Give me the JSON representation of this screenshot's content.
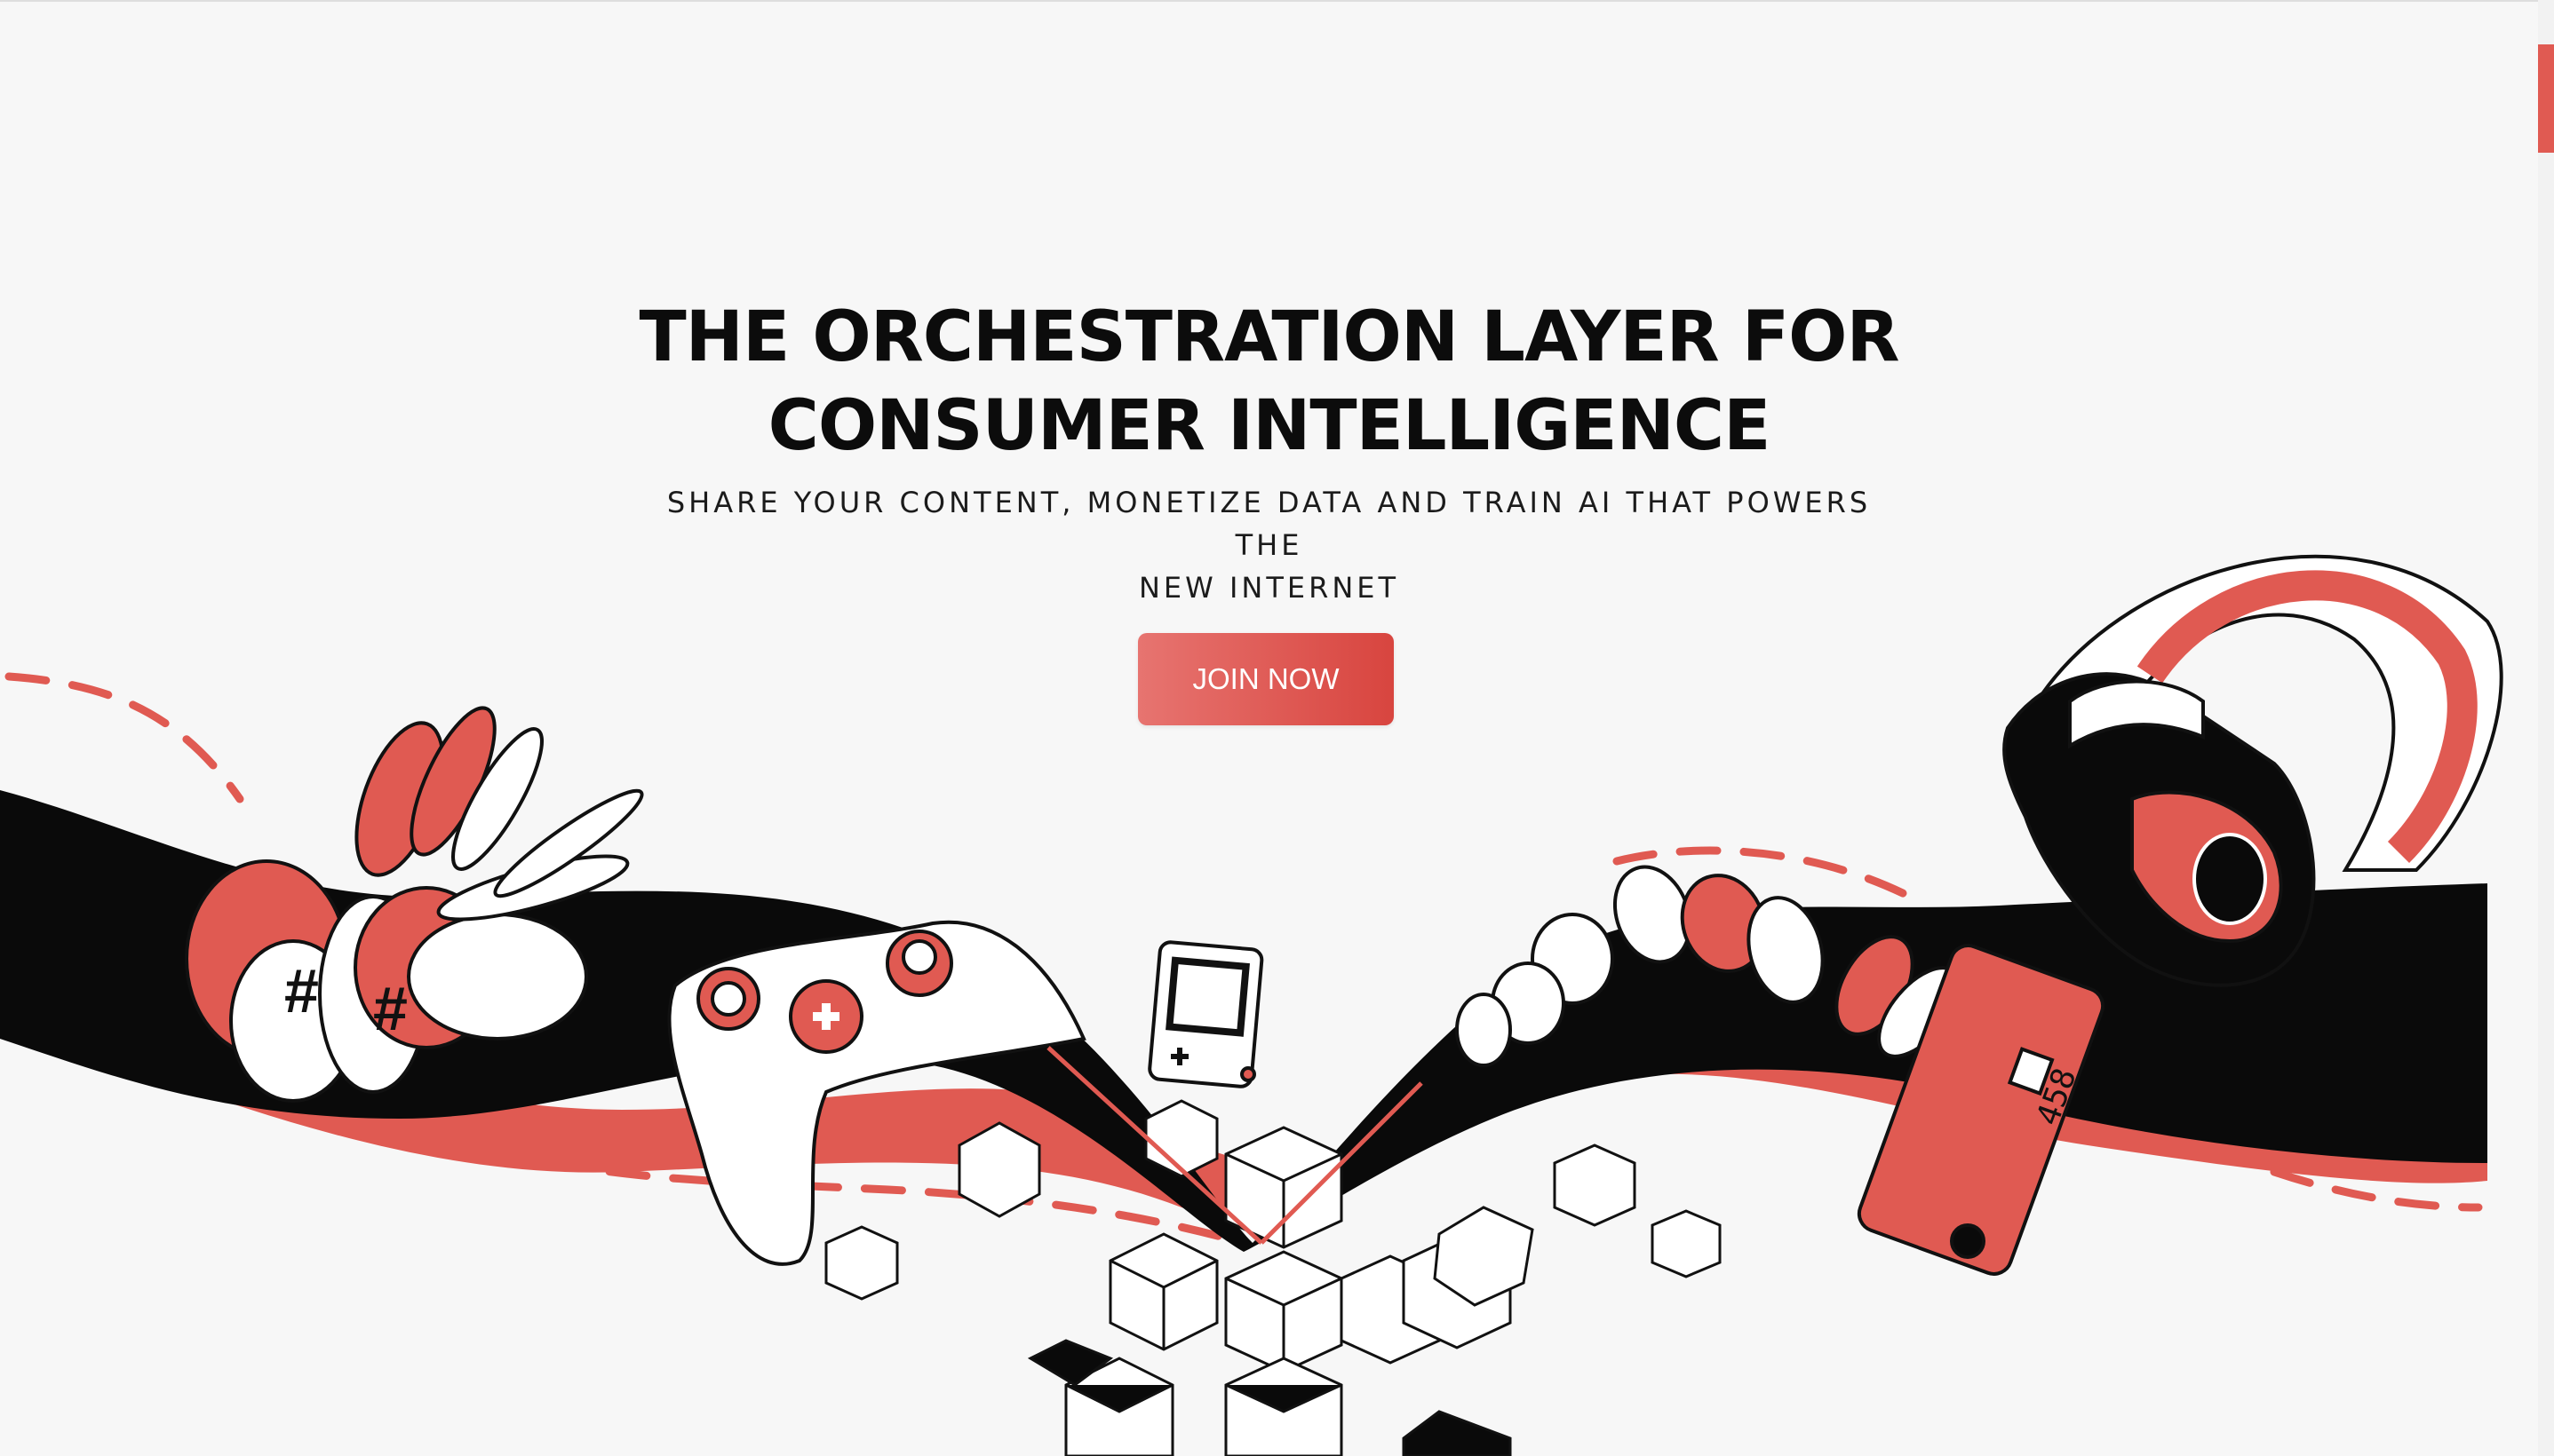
{
  "hero": {
    "headline_line1": "THE ORCHESTRATION LAYER FOR",
    "headline_line2": "CONSUMER INTELLIGENCE",
    "subheadline_line1": "SHARE YOUR CONTENT, MONETIZE DATA AND TRAIN AI THAT POWERS THE",
    "subheadline_line2": "NEW INTERNET",
    "cta_label": "JOIN NOW"
  },
  "illustration": {
    "card_number": "458",
    "icons": [
      "coins-icon",
      "game-controller-icon",
      "handheld-console-icon",
      "data-cubes-icon",
      "credit-card-icon",
      "vr-headset-icon"
    ]
  },
  "colors": {
    "accent": "#e05a52",
    "accent_dark": "#d8453f",
    "ink": "#0c0c0c",
    "background": "#f7f7f7"
  }
}
